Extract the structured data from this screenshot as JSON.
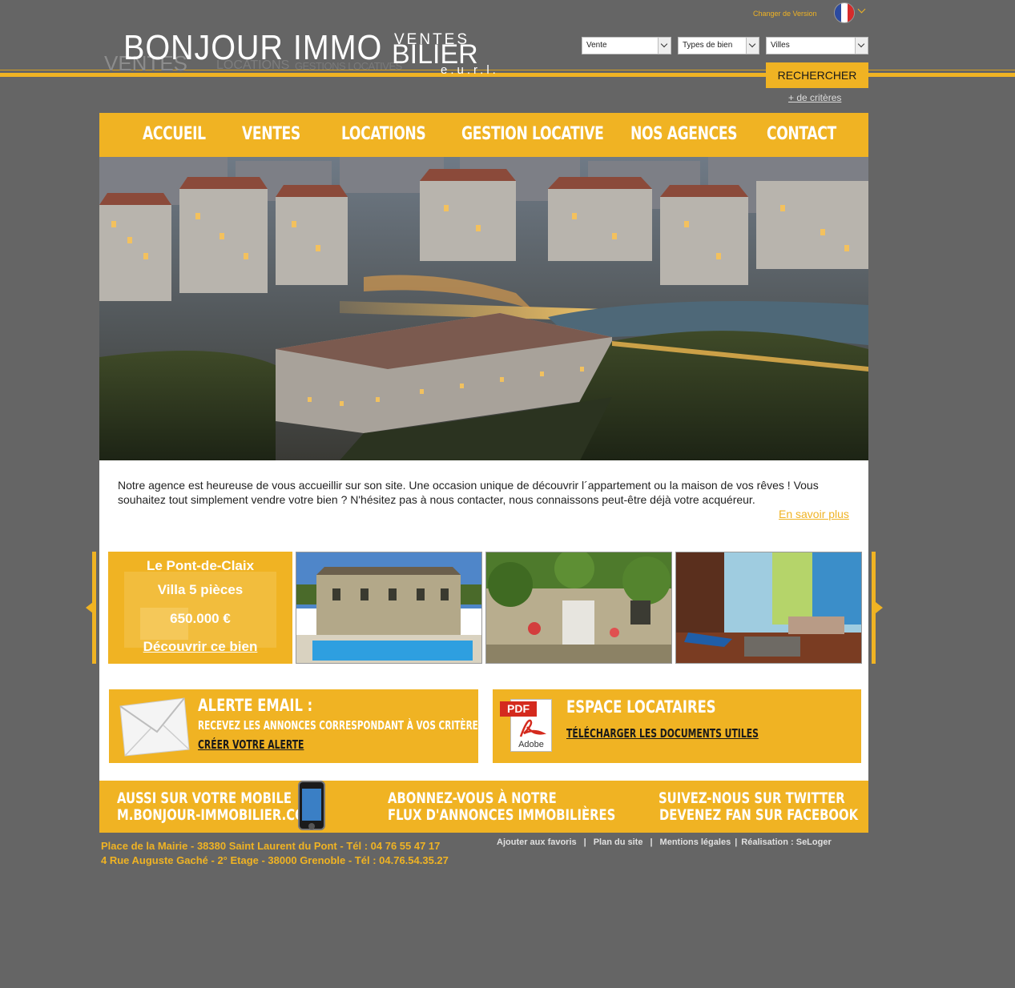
{
  "top_bar": {
    "change_version": "Changer de Version"
  },
  "logo": {
    "main": "BONJOUR IMMO",
    "ventes": "VENTES",
    "bilier": "BILIER",
    "eurl": "e.u.r.l."
  },
  "logo_shadow": {
    "ventes": "VENTES",
    "locations": "LOCATIONS",
    "gestion": "GESTIONS LOCATIVES"
  },
  "search": {
    "transaction": "Vente",
    "property_type": "Types de bien",
    "city": "Villes",
    "button": "RECHERCHER",
    "more": "+ de critères"
  },
  "nav": [
    "ACCUEIL",
    "VENTES",
    "LOCATIONS",
    "GESTION LOCATIVE",
    "NOS AGENCES",
    "CONTACT"
  ],
  "intro": {
    "text": "Notre agence est heureuse de vous accueillir sur son site. Une occasion unique de découvrir l´appartement ou la maison de vos rêves ! Vous souhaitez tout simplement vendre votre bien ? N'hésitez pas à nous contacter, nous connaissons peut-être déjà votre acquéreur.",
    "more": "En savoir plus"
  },
  "featured": {
    "city": "Le Pont-de-Claix",
    "type": "Villa 5 pièces",
    "price": "650.000 €",
    "link": "Découvrir ce bien"
  },
  "alert_box": {
    "title": "ALERTE EMAIL :",
    "subtitle": "RECEVEZ LES ANNONCES CORRESPONDANT À VOS CRITÈRES",
    "link": "CRÉER VOTRE ALERTE"
  },
  "tenant_box": {
    "title": "ESPACE LOCATAIRES",
    "link": "TÉLÉCHARGER LES DOCUMENTS UTILES",
    "pdf": "PDF",
    "adobe": "Adobe"
  },
  "band": {
    "mobile_line1": "AUSSI SUR VOTRE  MOBILE",
    "mobile_line2": "M.BONJOUR-IMMOBILIER.COM",
    "feed_line1": "ABONNEZ-VOUS À NOTRE",
    "feed_line2": "FLUX D'ANNONCES IMMOBILIÈRES",
    "social_line1": "SUIVEZ-NOUS SUR TWITTER",
    "social_line2": "DEVENEZ FAN SUR FACEBOOK"
  },
  "footer": {
    "address1": "Place de la Mairie - 38380 Saint Laurent du Pont - Tél : 04 76 55 47 17",
    "address2": "4 Rue Auguste Gaché - 2° Etage - 38000 Grenoble - Tél : 04.76.54.35.27",
    "links": [
      "Ajouter aux favoris",
      "Plan du site",
      "Mentions légales",
      "Réalisation : SeLoger"
    ],
    "separator": "|"
  },
  "colors": {
    "accent": "#f0b323",
    "background": "#656565",
    "white": "#ffffff"
  }
}
